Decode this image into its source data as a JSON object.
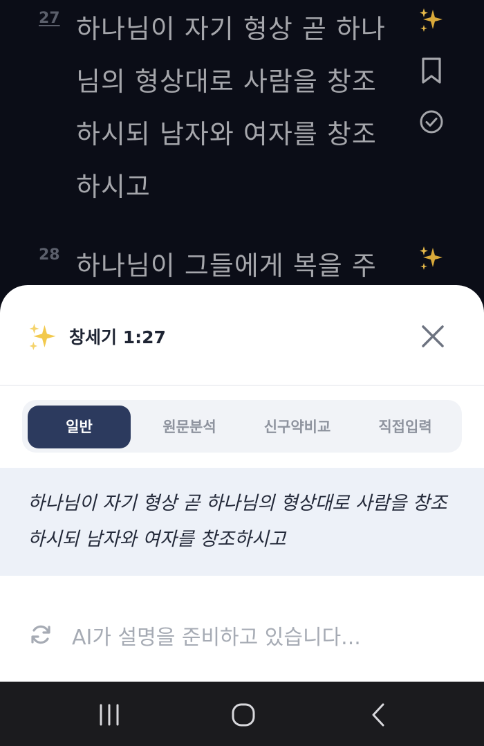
{
  "reader": {
    "verses": [
      {
        "number": "27",
        "lines": [
          "하나님이 자기 형상 곧 하나",
          "님의 형상대로 사람을 창조",
          "하시되 남자와 여자를 창조",
          "하시고"
        ]
      },
      {
        "number": "28",
        "lines": [
          "하나님이 그들에게 복을 주"
        ]
      }
    ],
    "icons": [
      "sparkles-icon",
      "bookmark-icon",
      "check-circle-icon"
    ]
  },
  "sheet": {
    "title": "창세기 1:27",
    "tabs": [
      {
        "label": "일반",
        "active": true
      },
      {
        "label": "원문분석",
        "active": false
      },
      {
        "label": "신구약비교",
        "active": false
      },
      {
        "label": "직접입력",
        "active": false
      }
    ],
    "quote": "하나님이 자기 형상 곧 하나님의 형상대로 사람을 창조하시되 남자와 여자를 창조하시고",
    "loading_text": "AI가 설명을 준비하고 있습니다..."
  },
  "colors": {
    "background": "#0b0d17",
    "tab_active": "#2c3a5e",
    "quote_bg": "#edf1f8",
    "sparkle": "#f2c94c"
  }
}
